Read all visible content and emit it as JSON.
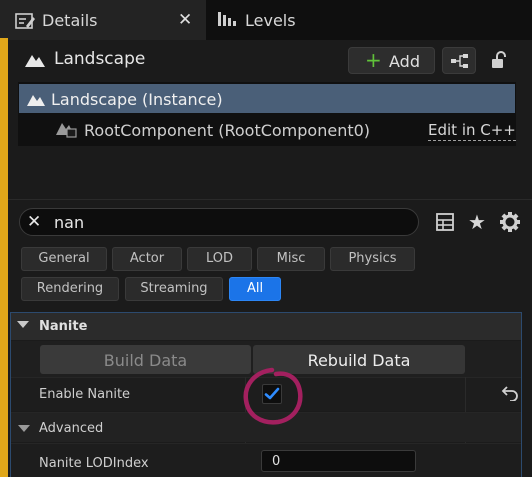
{
  "tabs": {
    "details_label": "Details",
    "levels_label": "Levels"
  },
  "header": {
    "title": "Landscape",
    "add_label": "Add"
  },
  "tree": {
    "instance_label": "Landscape (Instance)",
    "component_label": "RootComponent (RootComponent0)",
    "edit_link": "Edit in C++"
  },
  "search": {
    "value": "nan"
  },
  "filters": {
    "row1": [
      "General",
      "Actor",
      "LOD",
      "Misc",
      "Physics"
    ],
    "row2": [
      "Rendering",
      "Streaming",
      "All"
    ],
    "active": "All"
  },
  "nanite": {
    "section_label": "Nanite",
    "build_label": "Build Data",
    "rebuild_label": "Rebuild Data",
    "enable_label": "Enable Nanite",
    "enable_checked": true,
    "advanced_label": "Advanced",
    "lod_label": "Nanite LODIndex",
    "lod_value": "0"
  },
  "colors": {
    "accent_blue": "#1b74e8",
    "tab_accent": "#e0a71a",
    "annotation": "#a3205f",
    "add_plus": "#61c23a"
  }
}
